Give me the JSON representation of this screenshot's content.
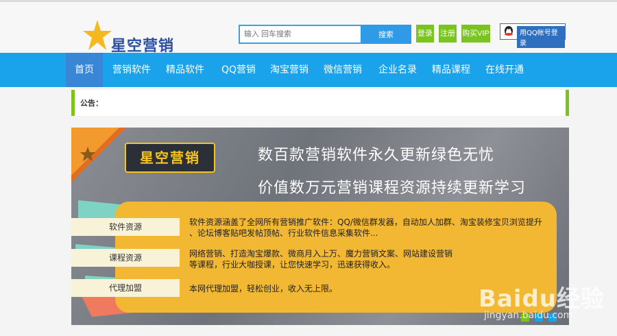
{
  "header": {
    "logo_text": "星空营销",
    "search_placeholder": "输入 回车搜索",
    "search_button": "搜索",
    "login_button": "登录",
    "register_button": "注册",
    "vip_button": "购买VIP",
    "qq_login": "用QQ帐号登录"
  },
  "nav": {
    "items": [
      {
        "label": "首页"
      },
      {
        "label": "营销软件"
      },
      {
        "label": "精品软件"
      },
      {
        "label": "QQ营销"
      },
      {
        "label": "淘宝营销"
      },
      {
        "label": "微信营销"
      },
      {
        "label": "企业名录"
      },
      {
        "label": "精品课程"
      },
      {
        "label": "在线开通"
      }
    ]
  },
  "notice": {
    "label": "公告："
  },
  "banner": {
    "brand": "星空营销",
    "headline1": "数百款营销软件永久更新绿色无忧",
    "headline2": "价值数万元营销课程资源持续更新学习",
    "rows": [
      {
        "tab": "软件资源",
        "line1": "软件资源涵盖了全网所有营销推广软件：QQ/微信群发器，自动加人加群、淘宝装修宝贝浏览提升",
        "line2": "、论坛博客贴吧发帖顶帖、行业软件信息采集软件..."
      },
      {
        "tab": "课程资源",
        "line1": "网络营销、打造淘宝爆款、微商月入上万、魔力营销文案、网站建设营销",
        "line2": "等课程，行业大咖授课，让您快速学习，迅速获得收入。"
      },
      {
        "tab": "代理加盟",
        "line1": "本网代理加盟，轻松创业，收入无上限。",
        "line2": ""
      }
    ]
  },
  "watermark": {
    "text": "Baidu经验",
    "url": "jingyan.baidu.com"
  },
  "colors": {
    "nav_bg": "#1aa3ea",
    "nav_active": "#3a86d6",
    "accent_green": "#79c51e",
    "search_blue": "#2e9ae8",
    "banner_yellow": "#f2b733"
  }
}
